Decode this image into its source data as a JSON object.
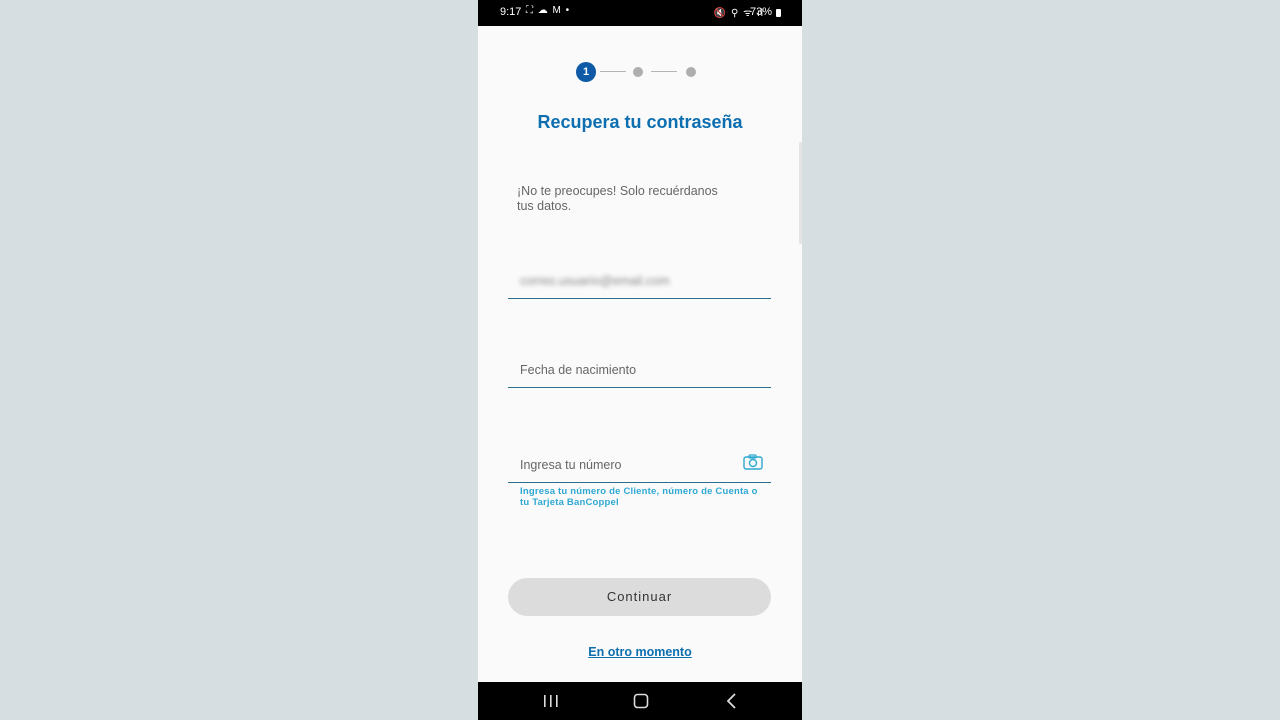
{
  "status_bar": {
    "time": "9:17",
    "left_icons": "⛶ ☁ M •",
    "right_icons": "🔇 ⚲ ᯤ ıl",
    "battery": "73%"
  },
  "stepper": {
    "current_step": "1",
    "total_steps": 3
  },
  "page": {
    "title": "Recupera tu contraseña",
    "subtitle": "¡No te preocupes! Solo recuérdanos tus datos."
  },
  "form": {
    "email_value": "correo.usuario@email.com",
    "birthdate_placeholder": "Fecha de nacimiento",
    "number_placeholder": "Ingresa tu número",
    "number_helper": "Ingresa tu número de Cliente, número de Cuenta o tu Tarjeta BanCoppel"
  },
  "actions": {
    "continue_label": "Continuar",
    "later_label": "En otro momento"
  },
  "icons": {
    "camera": "camera-icon",
    "recents": "recents-icon",
    "home": "home-icon",
    "back": "back-icon"
  },
  "colors": {
    "primary_blue": "#0d6fb0",
    "step_active": "#0f5aa6",
    "helper_text": "#2fa8d2",
    "button_disabled": "#dcdcdc"
  }
}
